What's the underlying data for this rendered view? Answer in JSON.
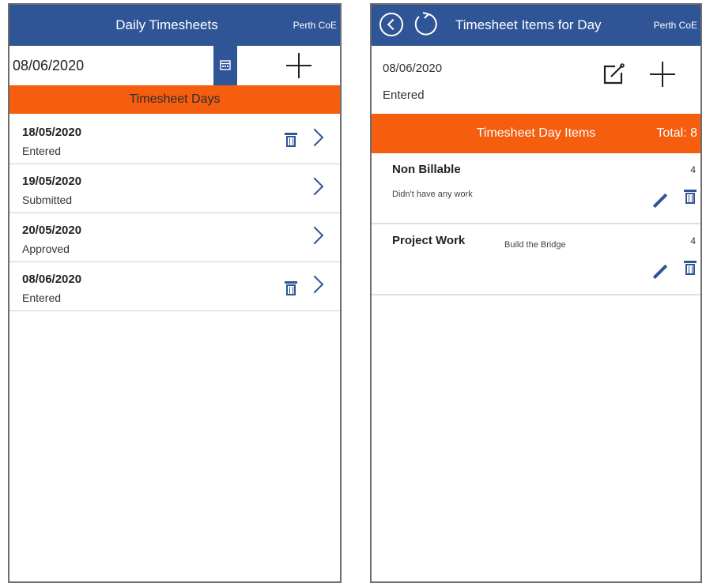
{
  "left": {
    "title": "Daily Timesheets",
    "org": "Perth CoE",
    "date_value": "08/06/2020",
    "banner": "Timesheet Days",
    "days": [
      {
        "date": "18/05/2020",
        "status": "Entered"
      },
      {
        "date": "19/05/2020",
        "status": "Submitted"
      },
      {
        "date": "20/05/2020",
        "status": "Approved"
      },
      {
        "date": "08/06/2020",
        "status": "Entered"
      }
    ],
    "icons": {
      "calendar": "calendar-icon",
      "add": "plus-icon",
      "delete": "trash-icon",
      "open": "chevron-right-icon"
    }
  },
  "right": {
    "title": "Timesheet Items for Day",
    "org": "Perth CoE",
    "date": "08/06/2020",
    "status": "Entered",
    "banner": "Timesheet Day Items",
    "total": "Total: 8",
    "items": [
      {
        "name": "Non Billable",
        "description": "Didn't have any work",
        "hours": "4"
      },
      {
        "name": "Project Work",
        "description": "Build the Bridge",
        "hours": "4"
      }
    ],
    "icons": {
      "back": "back-icon",
      "refresh": "refresh-icon",
      "edit_day": "edit-note-icon",
      "add": "plus-icon",
      "edit": "pencil-icon",
      "delete": "trash-icon"
    }
  },
  "colors": {
    "header": "#2f5597",
    "banner": "#f55d0f",
    "icon": "#2f5597"
  }
}
